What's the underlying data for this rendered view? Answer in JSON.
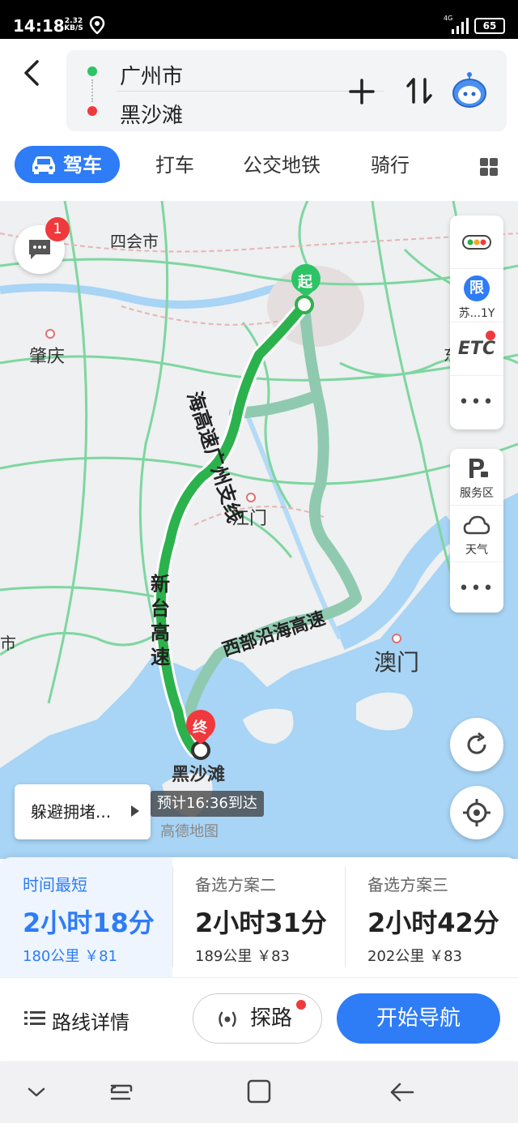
{
  "status_bar": {
    "time": "14:18",
    "speed_value": "2.32",
    "speed_unit": "KB/S",
    "network": "4G",
    "battery": "65"
  },
  "route": {
    "start": "广州市",
    "end": "黑沙滩"
  },
  "tabs": [
    {
      "label": "驾车",
      "active": true
    },
    {
      "label": "打车"
    },
    {
      "label": "公交地铁"
    },
    {
      "label": "骑行"
    }
  ],
  "map": {
    "labels": {
      "sihui": "四会市",
      "zhaoqing": "肇庆",
      "jiangmen": "江门",
      "macau": "澳门",
      "blackbeach": "黑沙滩",
      "left_edge": "市",
      "right_edge": "东"
    },
    "roads": {
      "guangzhou_branch": "海高速广州支线",
      "xintai": "新台高速",
      "western_coastal": "西部沿海高速"
    },
    "markers": {
      "start": "起",
      "end": "终"
    },
    "message_badge": "1",
    "side_panel_top": {
      "limit_badge": "限",
      "limit_label": "苏...1Y",
      "etc": "ETC",
      "more": "•••"
    },
    "side_panel_bottom": {
      "service_label": "服务区",
      "weather_label": "天气",
      "more": "•••"
    },
    "avoid_congestion": "躲避拥堵...",
    "eta": "预计16:36到达",
    "logo": "高德地图"
  },
  "plans": [
    {
      "name": "时间最短",
      "time": "2小时18分",
      "distance": "180公里 ￥81",
      "selected": true
    },
    {
      "name": "备选方案二",
      "time": "2小时31分",
      "distance": "189公里 ￥83"
    },
    {
      "name": "备选方案三",
      "time": "2小时42分",
      "distance": "202公里 ￥83"
    }
  ],
  "actions": {
    "details": "路线详情",
    "explore": "探路",
    "start_nav": "开始导航"
  },
  "colors": {
    "accent": "#2e7cf6",
    "route_main": "#2bb24c",
    "route_alt": "#8fcab0",
    "start_green": "#2cc465",
    "end_red": "#f0393d",
    "water": "#a8d4f5"
  }
}
